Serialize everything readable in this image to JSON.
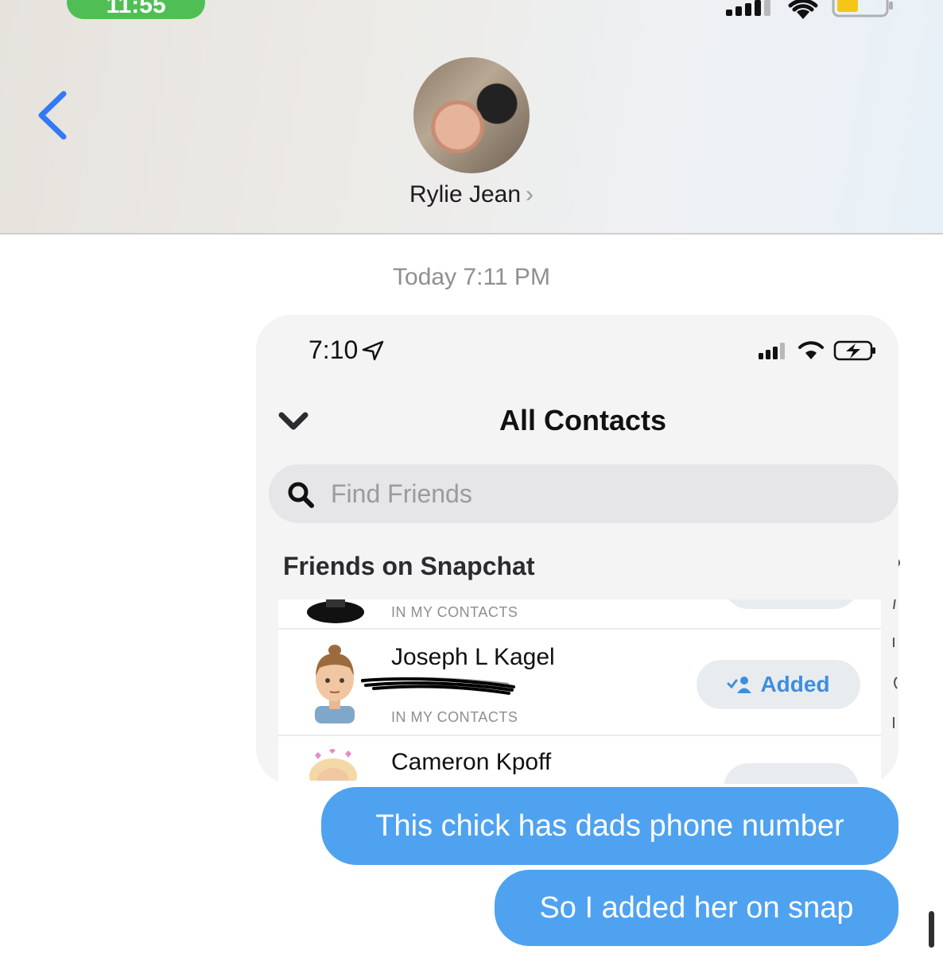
{
  "status_bar": {
    "time": "11:55"
  },
  "header": {
    "contact_name": "Rylie Jean",
    "chevron": "›",
    "back_icon": "chevron-left-icon"
  },
  "conversation": {
    "timestamp": "Today 7:11 PM",
    "messages": [
      {
        "text": "This chick has dads phone number",
        "sender": "me"
      },
      {
        "text": "So I added her on snap",
        "sender": "me"
      }
    ]
  },
  "screenshot": {
    "time": "7:10",
    "title": "All Contacts",
    "search": {
      "placeholder": "Find Friends",
      "value": ""
    },
    "section_title": "Friends on Snapchat",
    "rows": [
      {
        "name": "",
        "subtitle": "IN MY CONTACTS"
      },
      {
        "name": "Joseph L Kagel",
        "subtitle": "IN MY CONTACTS",
        "button_label": "Added"
      },
      {
        "name": "Cameron Kpoff",
        "subtitle": ""
      }
    ]
  },
  "colors": {
    "bubble": "#4fa2ef",
    "accent_blue": "#3d8ee0",
    "status_green": "#4fbf55"
  }
}
